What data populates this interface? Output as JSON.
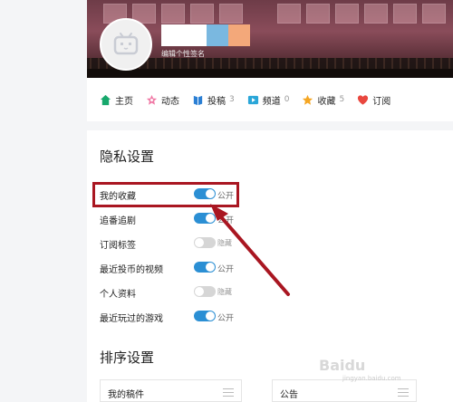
{
  "profile": {
    "signature": "编辑个性签名",
    "name_colors": [
      "#ffffff",
      "#7ab8e0",
      "#f3a87a"
    ]
  },
  "nav": [
    {
      "label": "主页",
      "icon": "home-icon",
      "color": "#17a86c",
      "count": ""
    },
    {
      "label": "动态",
      "icon": "dynamic-icon",
      "color": "#f07aa6",
      "count": ""
    },
    {
      "label": "投稿",
      "icon": "upload-icon",
      "color": "#2b7fd4",
      "count": "3"
    },
    {
      "label": "频道",
      "icon": "channel-icon",
      "color": "#2aa6d8",
      "count": "0"
    },
    {
      "label": "收藏",
      "icon": "favorite-icon",
      "color": "#f5a623",
      "count": "5"
    },
    {
      "label": "订阅",
      "icon": "subscribe-icon",
      "color": "#e9473f",
      "count": ""
    }
  ],
  "privacy": {
    "title": "隐私设置",
    "rows": [
      {
        "label": "我的收藏",
        "state": "on",
        "text": "公开"
      },
      {
        "label": "追番追剧",
        "state": "on",
        "text": "公开"
      },
      {
        "label": "订阅标签",
        "state": "off",
        "text": "隐藏"
      },
      {
        "label": "最近投币的视频",
        "state": "on",
        "text": "公开"
      },
      {
        "label": "个人资料",
        "state": "off",
        "text": "隐藏"
      },
      {
        "label": "最近玩过的游戏",
        "state": "on",
        "text": "公开"
      }
    ]
  },
  "sort": {
    "title": "排序设置",
    "boxes": [
      {
        "label": "我的稿件"
      },
      {
        "label": "公告"
      }
    ]
  },
  "watermark": {
    "main": "Baidu",
    "sub": "jingyan.baidu.com"
  },
  "annotation": {
    "color": "#a91621"
  }
}
